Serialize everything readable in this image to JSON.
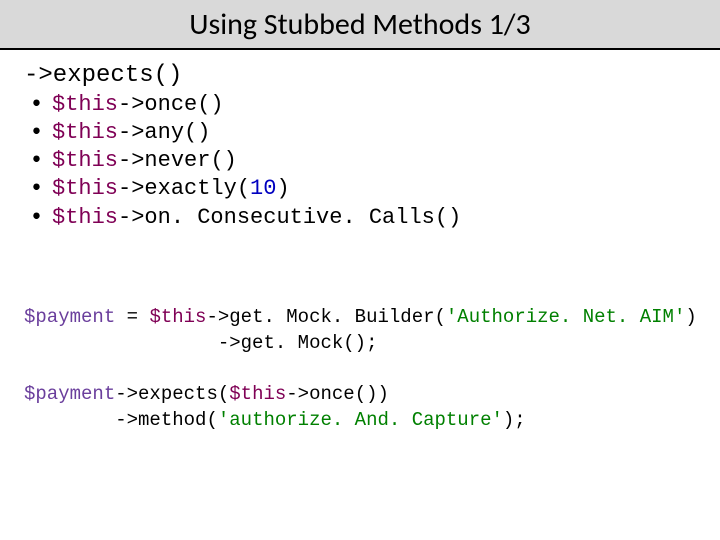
{
  "title": "Using Stubbed Methods 1/3",
  "section_head": "->expects()",
  "bullets": {
    "b0": {
      "kw": "$this",
      "arrow": "->",
      "call": "once",
      "par": "()"
    },
    "b1": {
      "kw": "$this",
      "arrow": "->",
      "call": "any",
      "par": "()"
    },
    "b2": {
      "kw": "$this",
      "arrow": "->",
      "call": "never",
      "par": "()"
    },
    "b3": {
      "kw": "$this",
      "arrow": "->",
      "call": "exactly",
      "lp": "(",
      "num": "10",
      "rp": ")"
    },
    "b4": {
      "kw": "$this",
      "arrow": "->",
      "call": "on. Consecutive. Calls",
      "par": "()"
    }
  },
  "code": {
    "l0": {
      "var": "$payment",
      "eq": " = ",
      "kw": "$this",
      "a1": "->",
      "c1": "get. Mock. Builder",
      "lp": "(",
      "str": "'Authorize. Net. AIM'",
      "rp": ")"
    },
    "l1": {
      "pad": "                 ",
      "a1": "->",
      "c1": "get. Mock",
      "par": "();"
    },
    "l2": {
      "text": ""
    },
    "l3": {
      "var": "$payment",
      "a1": "->",
      "c1": "expects",
      "lp": "(",
      "kw": "$this",
      "a2": "->",
      "c2": "once",
      "rp": "())"
    },
    "l4": {
      "pad": "        ",
      "a1": "->",
      "c1": "method",
      "lp": "(",
      "str": "'authorize. And. Capture'",
      "rp": ");"
    }
  }
}
